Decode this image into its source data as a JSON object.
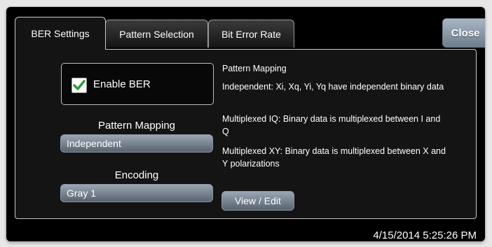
{
  "tabs": [
    {
      "label": "BER Settings",
      "active": true
    },
    {
      "label": "Pattern Selection",
      "active": false
    },
    {
      "label": "Bit Error Rate",
      "active": false
    }
  ],
  "close_label": "Close",
  "enable_ber": {
    "label": "Enable BER",
    "checked": true
  },
  "pattern_mapping": {
    "label": "Pattern Mapping",
    "value": "Independent"
  },
  "encoding": {
    "label": "Encoding",
    "value": "Gray 1"
  },
  "description": {
    "heading": "Pattern Mapping",
    "items": [
      "Independent: Xi, Xq, Yi, Yq have independent binary data",
      "Multiplexed IQ: Binary data is multiplexed between I and Q",
      "Multiplexed XY: Binary data is multiplexed between X and Y polarizations"
    ]
  },
  "view_edit_label": "View / Edit",
  "timestamp": "4/15/2014 5:25:26 PM",
  "colors": {
    "window_bg": "#000000",
    "button": "#7f8c99",
    "check": "#2e9b3a"
  }
}
